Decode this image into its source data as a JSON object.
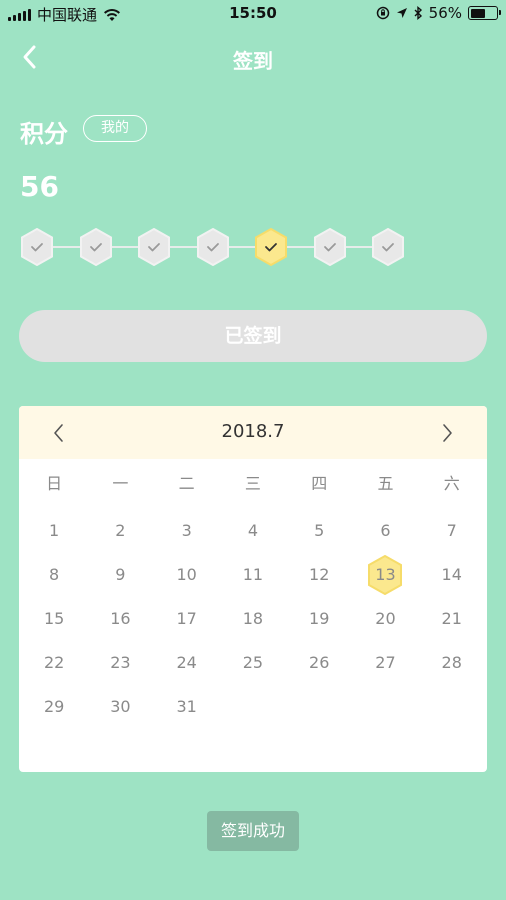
{
  "status_bar": {
    "carrier": "中国联通",
    "time": "15:50",
    "battery_percent": "56%",
    "battery_level": 0.56
  },
  "nav": {
    "title": "签到"
  },
  "points": {
    "label": "积分",
    "my_button": "我的",
    "value": "56"
  },
  "streak": {
    "days": [
      {
        "checked": false
      },
      {
        "checked": false
      },
      {
        "checked": false
      },
      {
        "checked": false
      },
      {
        "checked": true
      },
      {
        "checked": false
      },
      {
        "checked": false
      }
    ]
  },
  "signed_button": {
    "label": "已签到"
  },
  "calendar": {
    "month": "2018.7",
    "weekdays": [
      "日",
      "一",
      "二",
      "三",
      "四",
      "五",
      "六"
    ],
    "weeks": [
      [
        "1",
        "2",
        "3",
        "4",
        "5",
        "6",
        "7"
      ],
      [
        "8",
        "9",
        "10",
        "11",
        "12",
        "13",
        "14"
      ],
      [
        "15",
        "16",
        "17",
        "18",
        "19",
        "20",
        "21"
      ],
      [
        "22",
        "23",
        "24",
        "25",
        "26",
        "27",
        "28"
      ],
      [
        "29",
        "30",
        "31",
        "",
        "",
        "",
        ""
      ]
    ],
    "today": "13"
  },
  "toast": {
    "message": "签到成功"
  },
  "colors": {
    "background": "#9ee3c4",
    "highlight": "#fbe88e",
    "inactive_hex": "#e8e8e8",
    "calendar_header": "#fff9e6"
  }
}
